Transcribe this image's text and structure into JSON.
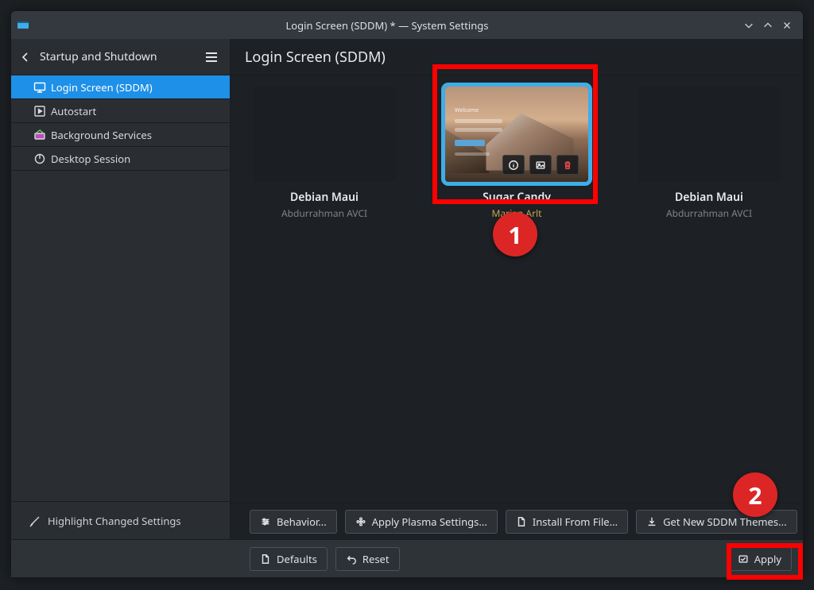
{
  "window": {
    "title": "Login Screen (SDDM) * — System Settings"
  },
  "sidebar": {
    "category": "Startup and Shutdown",
    "items": [
      {
        "label": "Login Screen (SDDM)",
        "selected": true,
        "icon": "monitor"
      },
      {
        "label": "Autostart",
        "selected": false,
        "icon": "play-square"
      },
      {
        "label": "Background Services",
        "selected": false,
        "icon": "services"
      },
      {
        "label": "Desktop Session",
        "selected": false,
        "icon": "power"
      }
    ],
    "footer": "Highlight Changed Settings"
  },
  "main": {
    "title": "Login Screen (SDDM)",
    "themes": [
      {
        "name": "Debian Maui",
        "author": "Abdurrahman AVCI",
        "selected": false
      },
      {
        "name": "Sugar Candy",
        "author": "Marian Arlt",
        "selected": true
      },
      {
        "name": "Debian Maui",
        "author": "Abdurrahman AVCI",
        "selected": false
      }
    ],
    "actions": {
      "behavior": "Behavior...",
      "apply_plasma": "Apply Plasma Settings...",
      "install_file": "Install From File...",
      "get_new": "Get New SDDM Themes..."
    }
  },
  "footer": {
    "defaults": "Defaults",
    "reset": "Reset",
    "apply": "Apply"
  },
  "annotations": {
    "one": "1",
    "two": "2"
  }
}
